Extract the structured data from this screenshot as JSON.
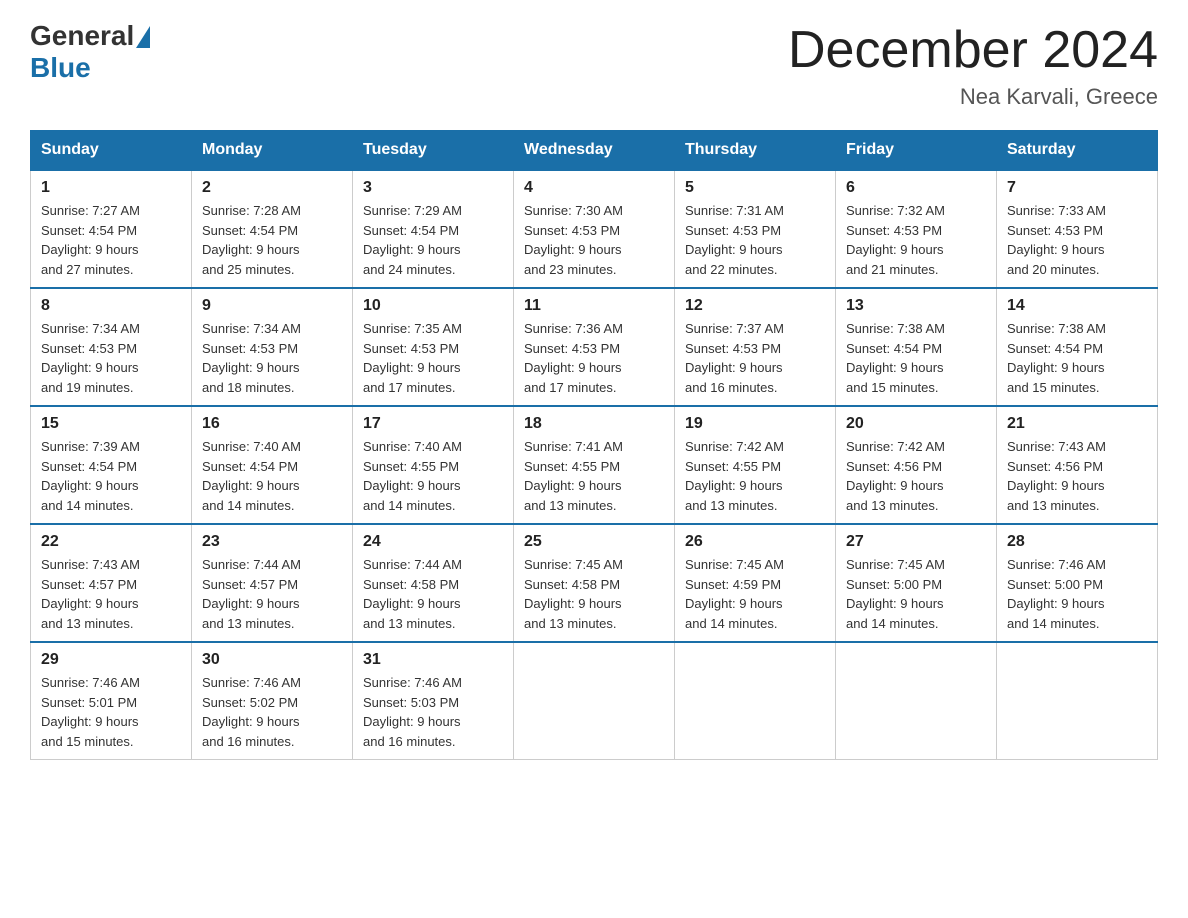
{
  "header": {
    "logo_general": "General",
    "logo_blue": "Blue",
    "month_title": "December 2024",
    "location": "Nea Karvali, Greece"
  },
  "days_of_week": [
    "Sunday",
    "Monday",
    "Tuesday",
    "Wednesday",
    "Thursday",
    "Friday",
    "Saturday"
  ],
  "weeks": [
    [
      {
        "day": "1",
        "sunrise": "7:27 AM",
        "sunset": "4:54 PM",
        "daylight": "9 hours and 27 minutes."
      },
      {
        "day": "2",
        "sunrise": "7:28 AM",
        "sunset": "4:54 PM",
        "daylight": "9 hours and 25 minutes."
      },
      {
        "day": "3",
        "sunrise": "7:29 AM",
        "sunset": "4:54 PM",
        "daylight": "9 hours and 24 minutes."
      },
      {
        "day": "4",
        "sunrise": "7:30 AM",
        "sunset": "4:53 PM",
        "daylight": "9 hours and 23 minutes."
      },
      {
        "day": "5",
        "sunrise": "7:31 AM",
        "sunset": "4:53 PM",
        "daylight": "9 hours and 22 minutes."
      },
      {
        "day": "6",
        "sunrise": "7:32 AM",
        "sunset": "4:53 PM",
        "daylight": "9 hours and 21 minutes."
      },
      {
        "day": "7",
        "sunrise": "7:33 AM",
        "sunset": "4:53 PM",
        "daylight": "9 hours and 20 minutes."
      }
    ],
    [
      {
        "day": "8",
        "sunrise": "7:34 AM",
        "sunset": "4:53 PM",
        "daylight": "9 hours and 19 minutes."
      },
      {
        "day": "9",
        "sunrise": "7:34 AM",
        "sunset": "4:53 PM",
        "daylight": "9 hours and 18 minutes."
      },
      {
        "day": "10",
        "sunrise": "7:35 AM",
        "sunset": "4:53 PM",
        "daylight": "9 hours and 17 minutes."
      },
      {
        "day": "11",
        "sunrise": "7:36 AM",
        "sunset": "4:53 PM",
        "daylight": "9 hours and 17 minutes."
      },
      {
        "day": "12",
        "sunrise": "7:37 AM",
        "sunset": "4:53 PM",
        "daylight": "9 hours and 16 minutes."
      },
      {
        "day": "13",
        "sunrise": "7:38 AM",
        "sunset": "4:54 PM",
        "daylight": "9 hours and 15 minutes."
      },
      {
        "day": "14",
        "sunrise": "7:38 AM",
        "sunset": "4:54 PM",
        "daylight": "9 hours and 15 minutes."
      }
    ],
    [
      {
        "day": "15",
        "sunrise": "7:39 AM",
        "sunset": "4:54 PM",
        "daylight": "9 hours and 14 minutes."
      },
      {
        "day": "16",
        "sunrise": "7:40 AM",
        "sunset": "4:54 PM",
        "daylight": "9 hours and 14 minutes."
      },
      {
        "day": "17",
        "sunrise": "7:40 AM",
        "sunset": "4:55 PM",
        "daylight": "9 hours and 14 minutes."
      },
      {
        "day": "18",
        "sunrise": "7:41 AM",
        "sunset": "4:55 PM",
        "daylight": "9 hours and 13 minutes."
      },
      {
        "day": "19",
        "sunrise": "7:42 AM",
        "sunset": "4:55 PM",
        "daylight": "9 hours and 13 minutes."
      },
      {
        "day": "20",
        "sunrise": "7:42 AM",
        "sunset": "4:56 PM",
        "daylight": "9 hours and 13 minutes."
      },
      {
        "day": "21",
        "sunrise": "7:43 AM",
        "sunset": "4:56 PM",
        "daylight": "9 hours and 13 minutes."
      }
    ],
    [
      {
        "day": "22",
        "sunrise": "7:43 AM",
        "sunset": "4:57 PM",
        "daylight": "9 hours and 13 minutes."
      },
      {
        "day": "23",
        "sunrise": "7:44 AM",
        "sunset": "4:57 PM",
        "daylight": "9 hours and 13 minutes."
      },
      {
        "day": "24",
        "sunrise": "7:44 AM",
        "sunset": "4:58 PM",
        "daylight": "9 hours and 13 minutes."
      },
      {
        "day": "25",
        "sunrise": "7:45 AM",
        "sunset": "4:58 PM",
        "daylight": "9 hours and 13 minutes."
      },
      {
        "day": "26",
        "sunrise": "7:45 AM",
        "sunset": "4:59 PM",
        "daylight": "9 hours and 14 minutes."
      },
      {
        "day": "27",
        "sunrise": "7:45 AM",
        "sunset": "5:00 PM",
        "daylight": "9 hours and 14 minutes."
      },
      {
        "day": "28",
        "sunrise": "7:46 AM",
        "sunset": "5:00 PM",
        "daylight": "9 hours and 14 minutes."
      }
    ],
    [
      {
        "day": "29",
        "sunrise": "7:46 AM",
        "sunset": "5:01 PM",
        "daylight": "9 hours and 15 minutes."
      },
      {
        "day": "30",
        "sunrise": "7:46 AM",
        "sunset": "5:02 PM",
        "daylight": "9 hours and 16 minutes."
      },
      {
        "day": "31",
        "sunrise": "7:46 AM",
        "sunset": "5:03 PM",
        "daylight": "9 hours and 16 minutes."
      },
      null,
      null,
      null,
      null
    ]
  ],
  "labels": {
    "sunrise_label": "Sunrise:",
    "sunset_label": "Sunset:",
    "daylight_label": "Daylight:"
  }
}
